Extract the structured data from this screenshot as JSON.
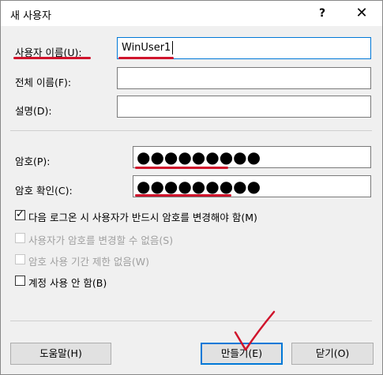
{
  "dialog": {
    "title": "새 사용자",
    "help_glyph": "?",
    "close_glyph": "✕"
  },
  "fields": {
    "username": {
      "label": "사용자 이름(U):",
      "value": "WinUser1"
    },
    "fullname": {
      "label": "전체 이름(F):",
      "value": ""
    },
    "description": {
      "label": "설명(D):",
      "value": ""
    },
    "password": {
      "label": "암호(P):",
      "value": "●●●●●●●●●"
    },
    "confirm": {
      "label": "암호 확인(C):",
      "value": "●●●●●●●●●"
    }
  },
  "options": [
    {
      "label": "다음 로그온 시 사용자가 반드시 암호를 변경해야 함(M)",
      "checked": true,
      "enabled": true,
      "mark": "✓"
    },
    {
      "label": "사용자가 암호를 변경할 수 없음(S)",
      "checked": false,
      "enabled": false,
      "mark": ""
    },
    {
      "label": "암호 사용 기간 제한 없음(W)",
      "checked": false,
      "enabled": false,
      "mark": ""
    },
    {
      "label": "계정 사용 안 함(B)",
      "checked": false,
      "enabled": true,
      "mark": ""
    }
  ],
  "buttons": {
    "help": "도움말(H)",
    "create": "만들기(E)",
    "close": "닫기(O)"
  },
  "colors": {
    "annotation_red": "#d0142c",
    "focus_blue": "#0078d7"
  }
}
